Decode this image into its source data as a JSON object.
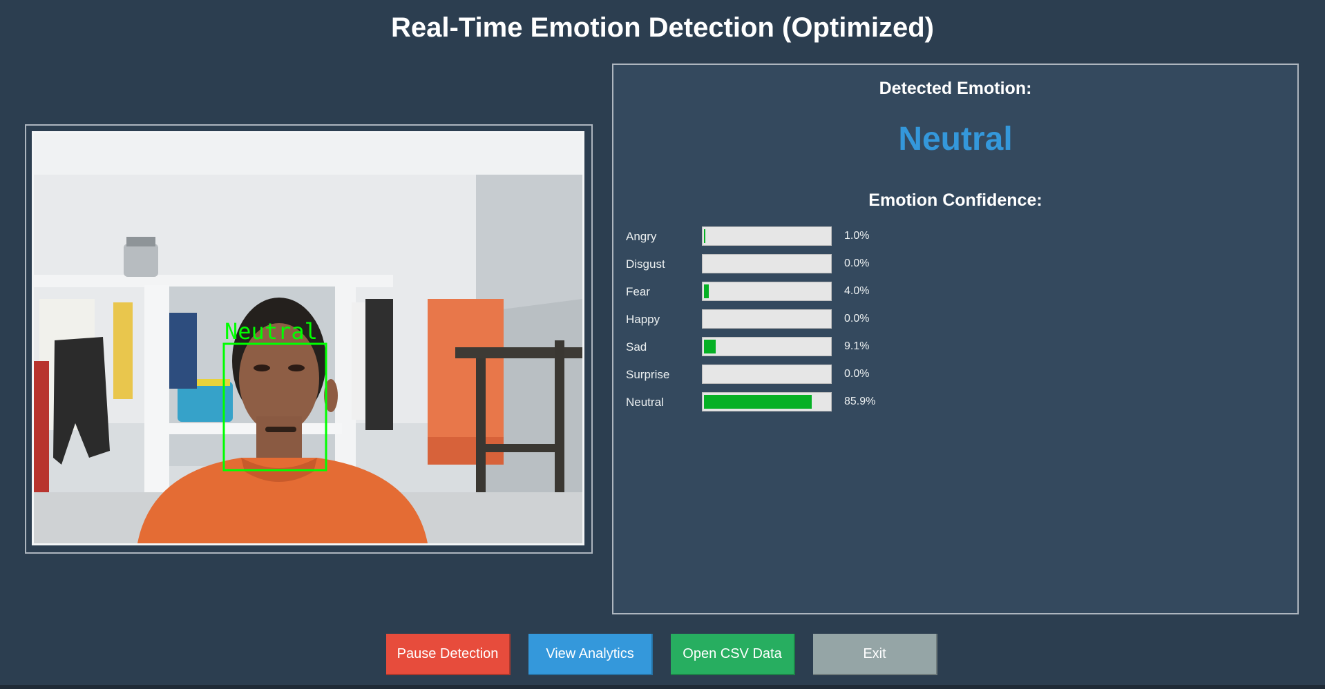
{
  "window": {
    "title": "Real-Time Emotion Detection (Optimized)"
  },
  "video": {
    "face_label": "Neutral",
    "box_color": "#00ff00"
  },
  "panel": {
    "detected_heading": "Detected Emotion:",
    "detected_value": "Neutral",
    "detected_color": "#3498db",
    "confidence_heading": "Emotion Confidence:",
    "bar_color": "#06b025",
    "emotions": [
      {
        "label": "Angry",
        "percent_text": "1.0%",
        "value": 1.0
      },
      {
        "label": "Disgust",
        "percent_text": "0.0%",
        "value": 0.0
      },
      {
        "label": "Fear",
        "percent_text": "4.0%",
        "value": 4.0
      },
      {
        "label": "Happy",
        "percent_text": "0.0%",
        "value": 0.0
      },
      {
        "label": "Sad",
        "percent_text": "9.1%",
        "value": 9.1
      },
      {
        "label": "Surprise",
        "percent_text": "0.0%",
        "value": 0.0
      },
      {
        "label": "Neutral",
        "percent_text": "85.9%",
        "value": 85.9
      }
    ]
  },
  "buttons": {
    "pause": {
      "label": "Pause Detection",
      "color": "#e74c3c"
    },
    "analytics": {
      "label": "View Analytics",
      "color": "#3498db"
    },
    "csv": {
      "label": "Open CSV Data",
      "color": "#27ae60"
    },
    "exit": {
      "label": "Exit",
      "color": "#95a5a6"
    }
  }
}
